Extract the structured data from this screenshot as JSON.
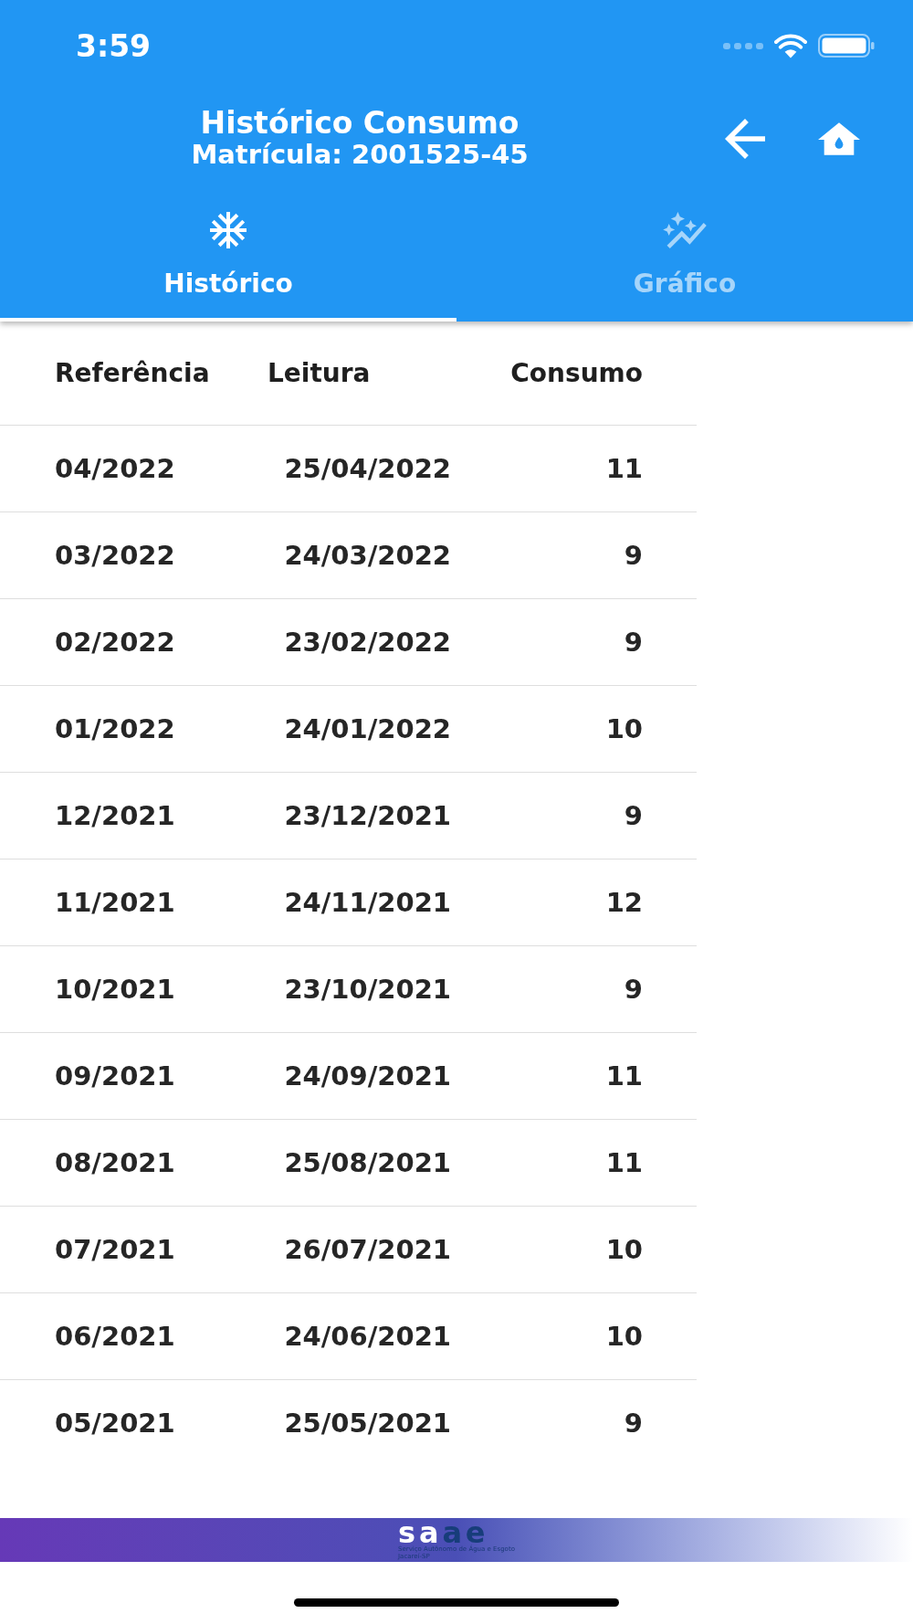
{
  "status_bar": {
    "time": "3:59"
  },
  "app_bar": {
    "title": "Histórico Consumo",
    "subtitle": "Matrícula: 2001525-45"
  },
  "tabs": [
    {
      "label": "Histórico",
      "selected": true
    },
    {
      "label": "Gráfico",
      "selected": false
    }
  ],
  "table": {
    "columns": [
      "Referência",
      "Leitura",
      "Consumo"
    ],
    "rows": [
      [
        "04/2022",
        "25/04/2022",
        "11"
      ],
      [
        "03/2022",
        "24/03/2022",
        "9"
      ],
      [
        "02/2022",
        "23/02/2022",
        "9"
      ],
      [
        "01/2022",
        "24/01/2022",
        "10"
      ],
      [
        "12/2021",
        "23/12/2021",
        "9"
      ],
      [
        "11/2021",
        "24/11/2021",
        "12"
      ],
      [
        "10/2021",
        "23/10/2021",
        "9"
      ],
      [
        "09/2021",
        "24/09/2021",
        "11"
      ],
      [
        "08/2021",
        "25/08/2021",
        "11"
      ],
      [
        "07/2021",
        "26/07/2021",
        "10"
      ],
      [
        "06/2021",
        "24/06/2021",
        "10"
      ],
      [
        "05/2021",
        "25/05/2021",
        "9"
      ]
    ]
  },
  "footer": {
    "logo": {
      "wordmark": [
        "sa",
        "ae"
      ],
      "tagline": "Serviço Autônomo de Água e Esgoto",
      "place": "Jacareí-SP"
    }
  }
}
